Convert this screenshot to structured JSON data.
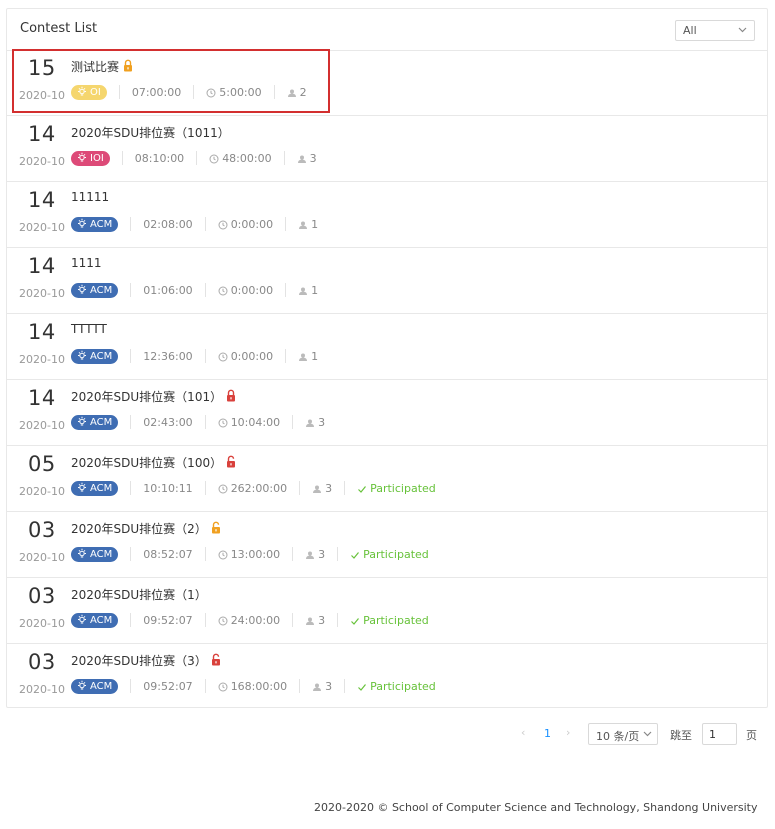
{
  "header": {
    "title": "Contest List",
    "filter_value": "All"
  },
  "contests": [
    {
      "day": "15",
      "month": "2020-10",
      "name": "测试比赛",
      "lock": "orange",
      "type": "OI",
      "type_color": "#f5d66e",
      "time": "07:00:00",
      "duration": "5:00:00",
      "count": "2",
      "participated": ""
    },
    {
      "day": "14",
      "month": "2020-10",
      "name": "2020年SDU排位赛（1011）",
      "lock": "",
      "type": "IOI",
      "type_color": "#dd4a78",
      "time": "08:10:00",
      "duration": "48:00:00",
      "count": "3",
      "participated": ""
    },
    {
      "day": "14",
      "month": "2020-10",
      "name": "11111",
      "lock": "",
      "type": "ACM",
      "type_color": "#3f6db3",
      "time": "02:08:00",
      "duration": "0:00:00",
      "count": "1",
      "participated": ""
    },
    {
      "day": "14",
      "month": "2020-10",
      "name": "1111",
      "lock": "",
      "type": "ACM",
      "type_color": "#3f6db3",
      "time": "01:06:00",
      "duration": "0:00:00",
      "count": "1",
      "participated": ""
    },
    {
      "day": "14",
      "month": "2020-10",
      "name": "TTTTT",
      "lock": "",
      "type": "ACM",
      "type_color": "#3f6db3",
      "time": "12:36:00",
      "duration": "0:00:00",
      "count": "1",
      "participated": ""
    },
    {
      "day": "14",
      "month": "2020-10",
      "name": "2020年SDU排位赛（101）",
      "lock": "red",
      "type": "ACM",
      "type_color": "#3f6db3",
      "time": "02:43:00",
      "duration": "10:04:00",
      "count": "3",
      "participated": ""
    },
    {
      "day": "05",
      "month": "2020-10",
      "name": "2020年SDU排位赛（100）",
      "lock": "red-open",
      "type": "ACM",
      "type_color": "#3f6db3",
      "time": "10:10:11",
      "duration": "262:00:00",
      "count": "3",
      "participated": "Participated"
    },
    {
      "day": "03",
      "month": "2020-10",
      "name": "2020年SDU排位赛（2）",
      "lock": "orange-open",
      "type": "ACM",
      "type_color": "#3f6db3",
      "time": "08:52:07",
      "duration": "13:00:00",
      "count": "3",
      "participated": "Participated"
    },
    {
      "day": "03",
      "month": "2020-10",
      "name": "2020年SDU排位赛（1）",
      "lock": "",
      "type": "ACM",
      "type_color": "#3f6db3",
      "time": "09:52:07",
      "duration": "24:00:00",
      "count": "3",
      "participated": "Participated"
    },
    {
      "day": "03",
      "month": "2020-10",
      "name": "2020年SDU排位赛（3）",
      "lock": "red-open",
      "type": "ACM",
      "type_color": "#3f6db3",
      "time": "09:52:07",
      "duration": "168:00:00",
      "count": "3",
      "participated": "Participated"
    }
  ],
  "pagination": {
    "prev": "‹",
    "current": "1",
    "next": "›",
    "page_size": "10 条/页",
    "goto_label": "跳至",
    "goto_value": "1",
    "page_label": "页"
  },
  "footer": {
    "text": "2020-2020 © School of Computer Science and Technology, Shandong University"
  },
  "colors": {
    "lock_orange": "#f0a020",
    "lock_red": "#d9413c",
    "participated": "#67c23a",
    "highlight": "#d32f2f"
  }
}
